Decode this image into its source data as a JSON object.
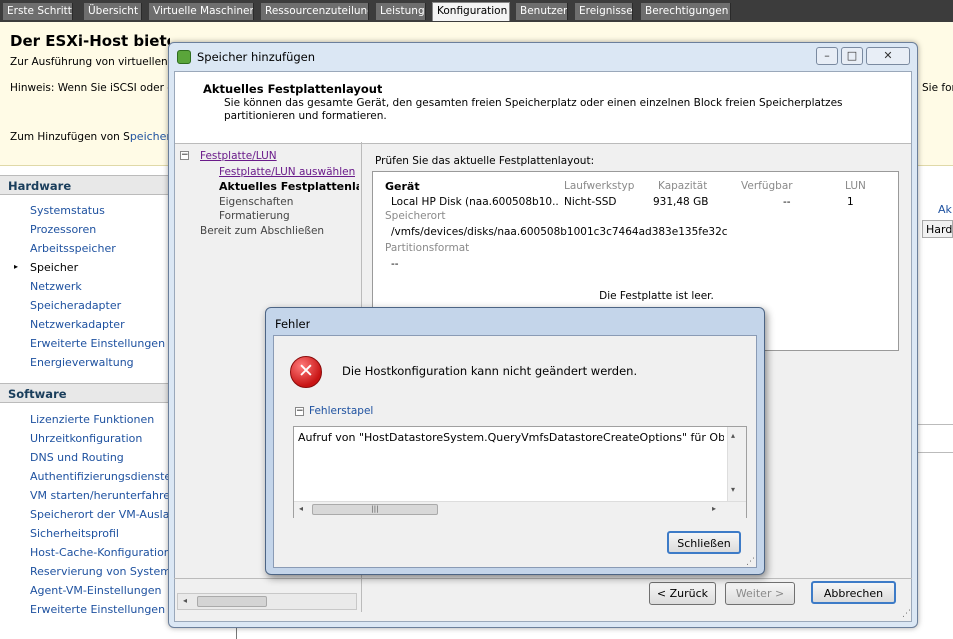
{
  "tabs": [
    "Erste Schritte",
    "Übersicht",
    "Virtuelle Maschinen",
    "Ressourcenzuteilung",
    "Leistung",
    "Konfiguration",
    "Benutzer",
    "Ereignisse",
    "Berechtigungen"
  ],
  "page": {
    "headline": "Der ESXi-Host bietet keine dauerhafte Speicherung",
    "sub": "Zur Ausführung von virtuellen Ma",
    "hint": "Hinweis: Wenn Sie iSCSI oder ein",
    "hint_right": "Sie for",
    "add_prefix": "Zum Hinzufügen von S",
    "add_link": "peicher k",
    "right_link": "Ak",
    "right_col": "Hardv"
  },
  "hardware": {
    "title": "Hardware",
    "items": [
      "Systemstatus",
      "Prozessoren",
      "Arbeitsspeicher",
      "Speicher",
      "Netzwerk",
      "Speicheradapter",
      "Netzwerkadapter",
      "Erweiterte Einstellungen",
      "Energieverwaltung"
    ]
  },
  "software": {
    "title": "Software",
    "items": [
      "Lizenzierte Funktionen",
      "Uhrzeitkonfiguration",
      "DNS und Routing",
      "Authentifizierungsdienste",
      "VM starten/herunterfahren",
      "Speicherort der VM-Auslager",
      "Sicherheitsprofil",
      "Host-Cache-Konfiguration",
      "Reservierung von Systemres",
      "Agent-VM-Einstellungen",
      "Erweiterte Einstellungen"
    ]
  },
  "dialog": {
    "title": "Speicher hinzufügen",
    "header_title": "Aktuelles Festplattenlayout",
    "header_desc": "Sie können das gesamte Gerät, den gesamten freien Speicherplatz oder einen einzelnen Block freien Speicherplatzes partitionieren und formatieren.",
    "tree_root": "Festplatte/LUN",
    "tree": [
      "Festplatte/LUN auswählen",
      "Aktuelles Festplattenlayout",
      "Eigenschaften",
      "Formatierung"
    ],
    "tree_last": "Bereit zum Abschließen",
    "check_label": "Prüfen Sie das aktuelle Festplattenlayout:",
    "col_device": "Gerät",
    "col_type": "Laufwerkstyp",
    "col_cap": "Kapazität",
    "col_avail": "Verfügbar",
    "col_lun": "LUN",
    "device": "Local HP Disk (naa.600508b10...",
    "type": "Nicht-SSD",
    "cap": "931,48 GB",
    "avail": "--",
    "lun": "1",
    "loc_label": "Speicherort",
    "loc": "/vmfs/devices/disks/naa.600508b1001c3c7464ad383e135fe32c",
    "part_label": "Partitionsformat",
    "part": "--",
    "empty": "Die Festplatte ist leer.",
    "back": "< Zurück",
    "next": "Weiter >",
    "cancel": "Abbrechen"
  },
  "error": {
    "title": "Fehler",
    "message": "Die Hostkonfiguration kann nicht geändert werden.",
    "stack_label": "Fehlerstapel",
    "stack_text": "Aufruf von \"HostDatastoreSystem.QueryVmfsDatastoreCreateOptions\" für Objek",
    "close": "Schließen"
  },
  "colors": {
    "accent": "#1f52a0",
    "error_red": "#d42020"
  }
}
